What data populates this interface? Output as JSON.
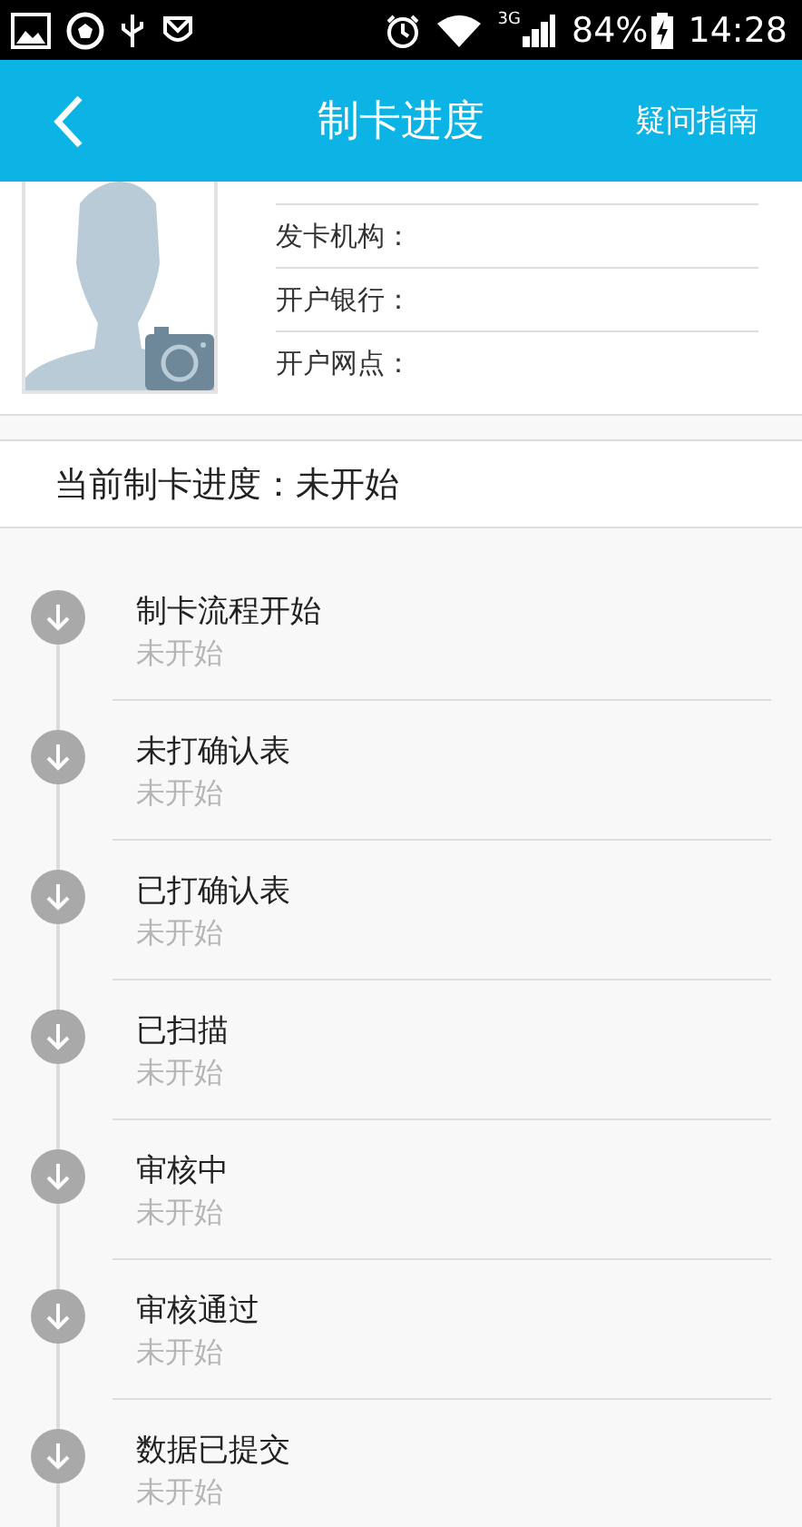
{
  "status_bar": {
    "network": "3G",
    "battery": "84%",
    "time": "14:28"
  },
  "header": {
    "title": "制卡进度",
    "action": "疑问指南"
  },
  "profile": {
    "fields": [
      {
        "label": "发卡机构："
      },
      {
        "label": "开户银行："
      },
      {
        "label": "开户网点："
      }
    ]
  },
  "current_progress": "当前制卡进度：未开始",
  "steps": [
    {
      "title": "制卡流程开始",
      "status": "未开始"
    },
    {
      "title": "未打确认表",
      "status": "未开始"
    },
    {
      "title": "已打确认表",
      "status": "未开始"
    },
    {
      "title": "已扫描",
      "status": "未开始"
    },
    {
      "title": "审核中",
      "status": "未开始"
    },
    {
      "title": "审核通过",
      "status": "未开始"
    },
    {
      "title": "数据已提交",
      "status": "未开始"
    }
  ]
}
